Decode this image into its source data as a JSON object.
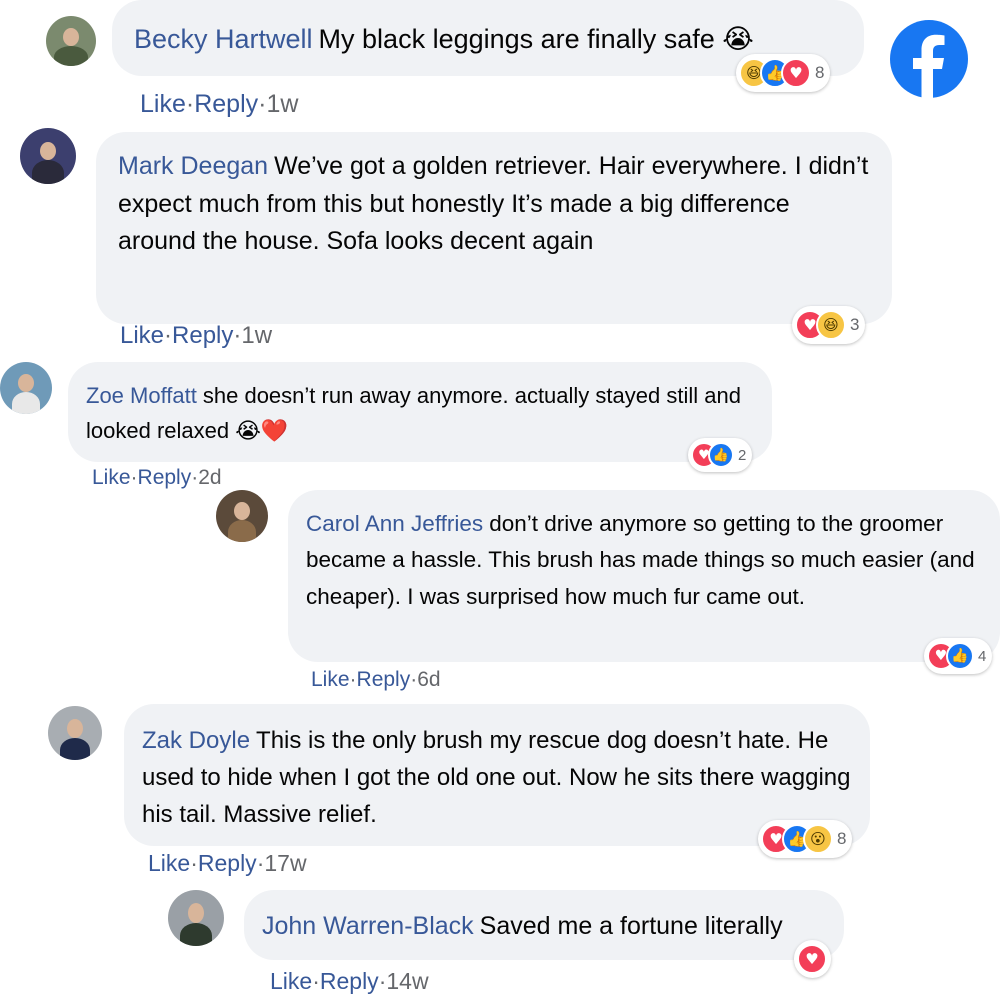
{
  "colors": {
    "name": "#385898",
    "bubble": "#f0f2f5",
    "like": "#1877f2",
    "love": "#f33e58",
    "haha": "#f7c544"
  },
  "brand_icon": "facebook-logo-icon",
  "actions": {
    "like": "Like",
    "reply": "Reply",
    "sep": "·"
  },
  "comments": [
    {
      "name": "Becky Hartwell",
      "text": "My black leggings are finally safe 😭",
      "time": "1w",
      "reactions": [
        "haha",
        "like",
        "love"
      ],
      "reaction_count": "8"
    },
    {
      "name": "Mark Deegan",
      "text": "We’ve got a golden retriever. Hair everywhere. I didn’t expect much from this but honestly It’s made a big difference around the house. Sofa looks decent again",
      "time": "1w",
      "reactions": [
        "love",
        "haha"
      ],
      "reaction_count": "3"
    },
    {
      "name": "Zoe Moffatt",
      "text": "she doesn’t run away anymore. actually stayed still and looked relaxed 😭❤️",
      "time": "2d",
      "reactions": [
        "love",
        "like"
      ],
      "reaction_count": "2"
    },
    {
      "name": "Carol Ann Jeffries",
      "text": "don’t drive anymore so getting to the groomer became a hassle. This brush has made things so much easier (and cheaper). I was surprised how much fur came out.",
      "time": "6d",
      "reactions": [
        "love",
        "like"
      ],
      "reaction_count": "4"
    },
    {
      "name": "Zak Doyle",
      "text": "This is the only brush my rescue dog doesn’t hate. He used to hide when I got the old one out. Now he sits there wagging his tail. Massive relief.",
      "time": "17w",
      "reactions": [
        "love",
        "like",
        "wow"
      ],
      "reaction_count": "8"
    },
    {
      "name": "John Warren-Black",
      "text": "Saved me a fortune literally",
      "time": "14w",
      "reactions": [
        "love"
      ],
      "reaction_count": ""
    }
  ]
}
